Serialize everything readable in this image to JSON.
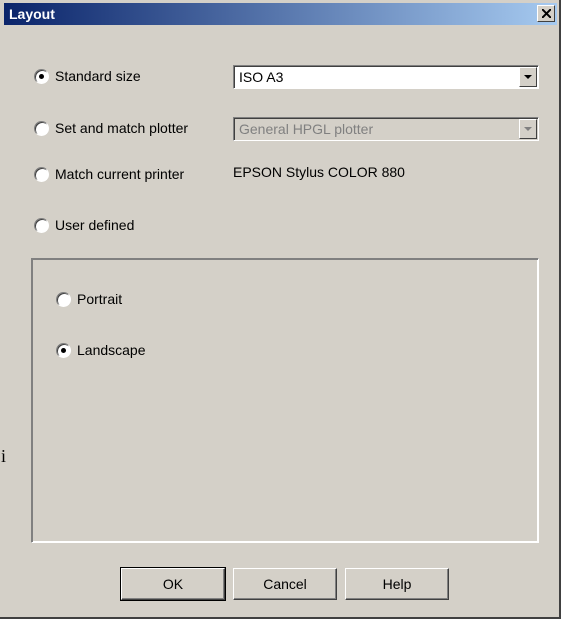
{
  "window": {
    "title": "Layout",
    "close_icon": "close-icon"
  },
  "size_options": [
    {
      "label": "Standard size",
      "selected": true
    },
    {
      "label": "Set and match plotter",
      "selected": false
    },
    {
      "label": "Match current printer",
      "selected": false
    },
    {
      "label": "User defined",
      "selected": false
    }
  ],
  "standard_size_combo": {
    "value": "ISO A3",
    "enabled": true
  },
  "plotter_combo": {
    "value": "General HPGL plotter",
    "enabled": false
  },
  "current_printer": "EPSON Stylus COLOR 880",
  "orientation": [
    {
      "label": "Portrait",
      "selected": false
    },
    {
      "label": "Landscape",
      "selected": true
    }
  ],
  "buttons": {
    "ok": "OK",
    "cancel": "Cancel",
    "help": "Help"
  },
  "edge_text": "i"
}
